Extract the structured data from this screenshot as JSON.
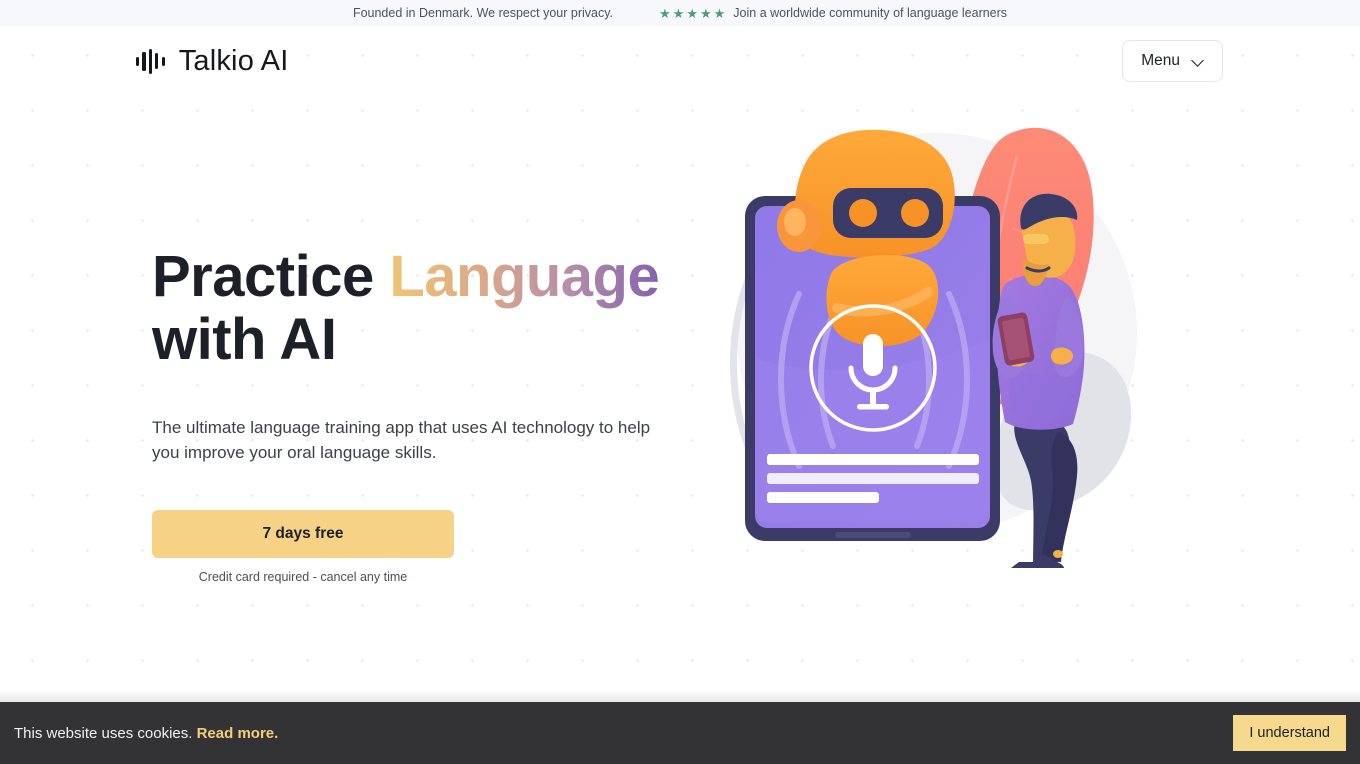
{
  "topbar": {
    "left_text": "Founded in Denmark. We respect your privacy.",
    "rating_stars": [
      "★",
      "★",
      "★",
      "★",
      "★"
    ],
    "star_icon_name": "star-icon",
    "star_color": "#4c9c74",
    "right_text": "Join a worldwide community of language learners"
  },
  "header": {
    "logo_icon": "waveform-icon",
    "brand_name": "Talkio AI",
    "menu_label": "Menu",
    "menu_chevron_icon": "chevron-down-icon"
  },
  "hero": {
    "headline_part1": "Practice ",
    "headline_highlight": "Language",
    "headline_part2": "with AI",
    "headline_gradient_from": "#f0c573",
    "headline_gradient_to": "#8463ae",
    "paragraph": "The ultimate language training app that uses AI technology to help you improve your oral language skills.",
    "cta_label": "7 days free",
    "cta_color": "#f6d287",
    "cta_note": "Credit card required - cancel any time",
    "illustration_name": "ai-language-tablet-illustration"
  },
  "cookie_bar": {
    "message": "This website uses cookies.",
    "link_label": "Read more.",
    "link_color": "#f3cf7c",
    "accept_label": "I understand",
    "accept_color": "#f6d98c",
    "background": "#333335"
  }
}
